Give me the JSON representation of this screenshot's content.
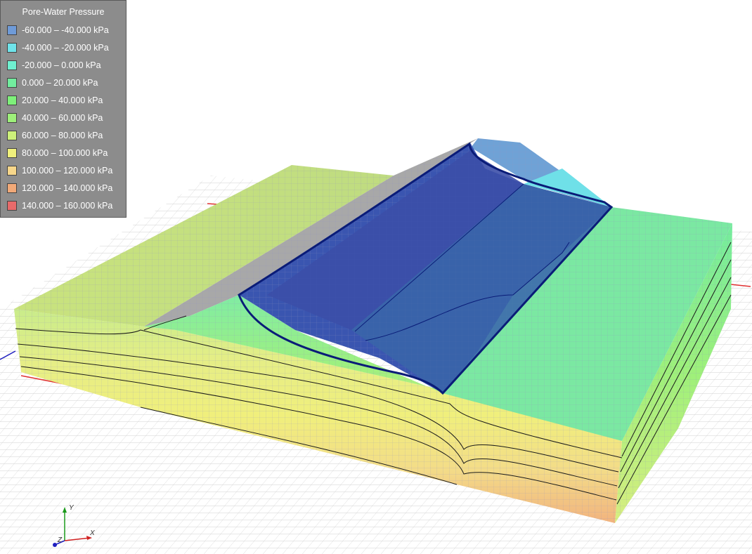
{
  "legend": {
    "title": "Pore-Water Pressure",
    "entries": [
      {
        "label": "-60.000 – -40.000 kPa",
        "color": "#6f9bd8"
      },
      {
        "label": "-40.000 – -20.000 kPa",
        "color": "#6fe3ea"
      },
      {
        "label": "-20.000 – 0.000 kPa",
        "color": "#6ff0d0"
      },
      {
        "label": "0.000 – 20.000 kPa",
        "color": "#72ec9e"
      },
      {
        "label": "20.000 – 40.000 kPa",
        "color": "#7ef07a"
      },
      {
        "label": "40.000 – 60.000 kPa",
        "color": "#9ef07a"
      },
      {
        "label": "60.000 – 80.000 kPa",
        "color": "#cdf07a"
      },
      {
        "label": "80.000 – 100.000 kPa",
        "color": "#f0f07c"
      },
      {
        "label": "100.000 – 120.000 kPa",
        "color": "#f6d68a"
      },
      {
        "label": "120.000 – 140.000 kPa",
        "color": "#f1a978"
      },
      {
        "label": "140.000 – 160.000 kPa",
        "color": "#e86a6a"
      }
    ]
  },
  "triad": {
    "y_label": "Y",
    "x_label": "X",
    "z_label": "Z"
  },
  "colors": {
    "phreatic_line": "#0a1c78",
    "ground_grid": "#c8c8c8",
    "x_axis": "#e03030",
    "z_axis": "#2020c0"
  }
}
